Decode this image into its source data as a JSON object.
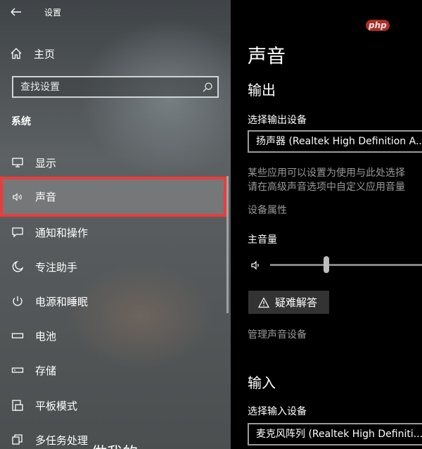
{
  "window": {
    "title": "设置"
  },
  "nav": {
    "home_label": "主页",
    "search_placeholder": "查找设置",
    "section_title": "系统",
    "items": [
      {
        "label": "显示",
        "icon": "monitor-icon"
      },
      {
        "label": "声音",
        "icon": "speaker-icon",
        "selected": true
      },
      {
        "label": "通知和操作",
        "icon": "notification-icon"
      },
      {
        "label": "专注助手",
        "icon": "moon-icon"
      },
      {
        "label": "电源和睡眠",
        "icon": "power-icon"
      },
      {
        "label": "电池",
        "icon": "battery-icon"
      },
      {
        "label": "存储",
        "icon": "storage-icon"
      },
      {
        "label": "平板模式",
        "icon": "tablet-icon"
      },
      {
        "label": "多任务处理",
        "icon": "multitask-icon"
      }
    ]
  },
  "main": {
    "watermark": "php",
    "title": "声音",
    "output": {
      "heading": "输出",
      "device_label": "选择输出设备",
      "device_value": "扬声器 (Realtek High Definition A...",
      "description_line1": "某些应用可以设置为使用与此处选择",
      "description_line2": "请在高级声音选项中自定义应用音量",
      "device_properties_link": "设备属性",
      "master_volume_label": "主音量",
      "master_volume_level": 0.37,
      "troubleshoot_label": "疑难解答",
      "manage_devices_link": "管理声音设备"
    },
    "input": {
      "heading": "输入",
      "device_label": "选择输入设备",
      "device_value": "麦克风阵列 (Realtek High Definiti..."
    }
  },
  "overlay": {
    "text": "做我的"
  },
  "colors": {
    "highlight_border": "#ec3b3b",
    "right_bg": "#000000",
    "link": "#999999"
  }
}
